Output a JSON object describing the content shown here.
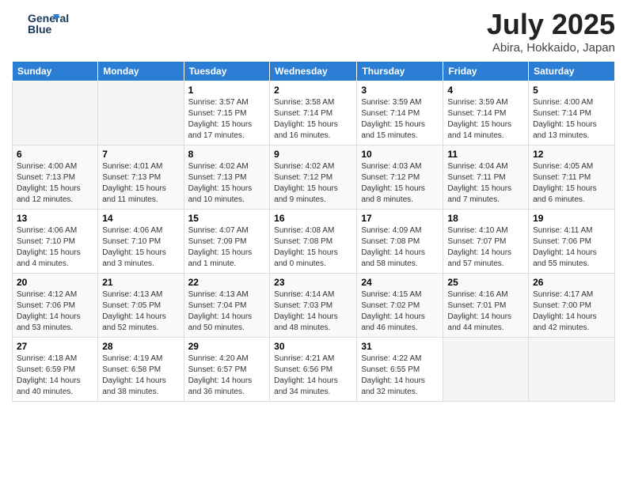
{
  "header": {
    "logo_line1": "General",
    "logo_line2": "Blue",
    "month_title": "July 2025",
    "location": "Abira, Hokkaido, Japan"
  },
  "days_of_week": [
    "Sunday",
    "Monday",
    "Tuesday",
    "Wednesday",
    "Thursday",
    "Friday",
    "Saturday"
  ],
  "weeks": [
    [
      {
        "day": "",
        "sunrise": "",
        "sunset": "",
        "daylight": ""
      },
      {
        "day": "",
        "sunrise": "",
        "sunset": "",
        "daylight": ""
      },
      {
        "day": "1",
        "sunrise": "Sunrise: 3:57 AM",
        "sunset": "Sunset: 7:15 PM",
        "daylight": "Daylight: 15 hours and 17 minutes."
      },
      {
        "day": "2",
        "sunrise": "Sunrise: 3:58 AM",
        "sunset": "Sunset: 7:14 PM",
        "daylight": "Daylight: 15 hours and 16 minutes."
      },
      {
        "day": "3",
        "sunrise": "Sunrise: 3:59 AM",
        "sunset": "Sunset: 7:14 PM",
        "daylight": "Daylight: 15 hours and 15 minutes."
      },
      {
        "day": "4",
        "sunrise": "Sunrise: 3:59 AM",
        "sunset": "Sunset: 7:14 PM",
        "daylight": "Daylight: 15 hours and 14 minutes."
      },
      {
        "day": "5",
        "sunrise": "Sunrise: 4:00 AM",
        "sunset": "Sunset: 7:14 PM",
        "daylight": "Daylight: 15 hours and 13 minutes."
      }
    ],
    [
      {
        "day": "6",
        "sunrise": "Sunrise: 4:00 AM",
        "sunset": "Sunset: 7:13 PM",
        "daylight": "Daylight: 15 hours and 12 minutes."
      },
      {
        "day": "7",
        "sunrise": "Sunrise: 4:01 AM",
        "sunset": "Sunset: 7:13 PM",
        "daylight": "Daylight: 15 hours and 11 minutes."
      },
      {
        "day": "8",
        "sunrise": "Sunrise: 4:02 AM",
        "sunset": "Sunset: 7:13 PM",
        "daylight": "Daylight: 15 hours and 10 minutes."
      },
      {
        "day": "9",
        "sunrise": "Sunrise: 4:02 AM",
        "sunset": "Sunset: 7:12 PM",
        "daylight": "Daylight: 15 hours and 9 minutes."
      },
      {
        "day": "10",
        "sunrise": "Sunrise: 4:03 AM",
        "sunset": "Sunset: 7:12 PM",
        "daylight": "Daylight: 15 hours and 8 minutes."
      },
      {
        "day": "11",
        "sunrise": "Sunrise: 4:04 AM",
        "sunset": "Sunset: 7:11 PM",
        "daylight": "Daylight: 15 hours and 7 minutes."
      },
      {
        "day": "12",
        "sunrise": "Sunrise: 4:05 AM",
        "sunset": "Sunset: 7:11 PM",
        "daylight": "Daylight: 15 hours and 6 minutes."
      }
    ],
    [
      {
        "day": "13",
        "sunrise": "Sunrise: 4:06 AM",
        "sunset": "Sunset: 7:10 PM",
        "daylight": "Daylight: 15 hours and 4 minutes."
      },
      {
        "day": "14",
        "sunrise": "Sunrise: 4:06 AM",
        "sunset": "Sunset: 7:10 PM",
        "daylight": "Daylight: 15 hours and 3 minutes."
      },
      {
        "day": "15",
        "sunrise": "Sunrise: 4:07 AM",
        "sunset": "Sunset: 7:09 PM",
        "daylight": "Daylight: 15 hours and 1 minute."
      },
      {
        "day": "16",
        "sunrise": "Sunrise: 4:08 AM",
        "sunset": "Sunset: 7:08 PM",
        "daylight": "Daylight: 15 hours and 0 minutes."
      },
      {
        "day": "17",
        "sunrise": "Sunrise: 4:09 AM",
        "sunset": "Sunset: 7:08 PM",
        "daylight": "Daylight: 14 hours and 58 minutes."
      },
      {
        "day": "18",
        "sunrise": "Sunrise: 4:10 AM",
        "sunset": "Sunset: 7:07 PM",
        "daylight": "Daylight: 14 hours and 57 minutes."
      },
      {
        "day": "19",
        "sunrise": "Sunrise: 4:11 AM",
        "sunset": "Sunset: 7:06 PM",
        "daylight": "Daylight: 14 hours and 55 minutes."
      }
    ],
    [
      {
        "day": "20",
        "sunrise": "Sunrise: 4:12 AM",
        "sunset": "Sunset: 7:06 PM",
        "daylight": "Daylight: 14 hours and 53 minutes."
      },
      {
        "day": "21",
        "sunrise": "Sunrise: 4:13 AM",
        "sunset": "Sunset: 7:05 PM",
        "daylight": "Daylight: 14 hours and 52 minutes."
      },
      {
        "day": "22",
        "sunrise": "Sunrise: 4:13 AM",
        "sunset": "Sunset: 7:04 PM",
        "daylight": "Daylight: 14 hours and 50 minutes."
      },
      {
        "day": "23",
        "sunrise": "Sunrise: 4:14 AM",
        "sunset": "Sunset: 7:03 PM",
        "daylight": "Daylight: 14 hours and 48 minutes."
      },
      {
        "day": "24",
        "sunrise": "Sunrise: 4:15 AM",
        "sunset": "Sunset: 7:02 PM",
        "daylight": "Daylight: 14 hours and 46 minutes."
      },
      {
        "day": "25",
        "sunrise": "Sunrise: 4:16 AM",
        "sunset": "Sunset: 7:01 PM",
        "daylight": "Daylight: 14 hours and 44 minutes."
      },
      {
        "day": "26",
        "sunrise": "Sunrise: 4:17 AM",
        "sunset": "Sunset: 7:00 PM",
        "daylight": "Daylight: 14 hours and 42 minutes."
      }
    ],
    [
      {
        "day": "27",
        "sunrise": "Sunrise: 4:18 AM",
        "sunset": "Sunset: 6:59 PM",
        "daylight": "Daylight: 14 hours and 40 minutes."
      },
      {
        "day": "28",
        "sunrise": "Sunrise: 4:19 AM",
        "sunset": "Sunset: 6:58 PM",
        "daylight": "Daylight: 14 hours and 38 minutes."
      },
      {
        "day": "29",
        "sunrise": "Sunrise: 4:20 AM",
        "sunset": "Sunset: 6:57 PM",
        "daylight": "Daylight: 14 hours and 36 minutes."
      },
      {
        "day": "30",
        "sunrise": "Sunrise: 4:21 AM",
        "sunset": "Sunset: 6:56 PM",
        "daylight": "Daylight: 14 hours and 34 minutes."
      },
      {
        "day": "31",
        "sunrise": "Sunrise: 4:22 AM",
        "sunset": "Sunset: 6:55 PM",
        "daylight": "Daylight: 14 hours and 32 minutes."
      },
      {
        "day": "",
        "sunrise": "",
        "sunset": "",
        "daylight": ""
      },
      {
        "day": "",
        "sunrise": "",
        "sunset": "",
        "daylight": ""
      }
    ]
  ]
}
